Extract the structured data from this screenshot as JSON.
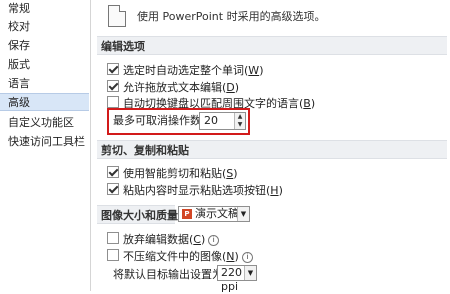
{
  "sidebar": {
    "items": [
      {
        "label": "常规"
      },
      {
        "label": "校对"
      },
      {
        "label": "保存"
      },
      {
        "label": "版式"
      },
      {
        "label": "语言"
      },
      {
        "label": "高级"
      },
      {
        "label": "自定义功能区"
      },
      {
        "label": "快速访问工具栏"
      }
    ],
    "selected": "高级"
  },
  "header": {
    "text": "使用 PowerPoint 时采用的高级选项。"
  },
  "sections": {
    "editing": {
      "title": "编辑选项",
      "options": [
        {
          "label": "选定时自动选定整个单词(",
          "key": "W",
          "suffix": ")",
          "checked": true
        },
        {
          "label": "允许拖放式文本编辑(",
          "key": "D",
          "suffix": ")",
          "checked": true
        },
        {
          "label": "自动切换键盘以匹配周围文字的语言(",
          "key": "B",
          "suffix": ")",
          "checked": false
        }
      ],
      "undo_label": "最多可取消操作数(X):",
      "undo_value": "20"
    },
    "clipboard": {
      "title": "剪切、复制和粘贴",
      "options": [
        {
          "label": "使用智能剪切和粘贴(",
          "key": "S",
          "suffix": ")",
          "checked": true
        },
        {
          "label": "粘贴内容时显示粘贴选项按钮(",
          "key": "H",
          "suffix": ")",
          "checked": true
        }
      ]
    },
    "image": {
      "title": "图像大小和质量",
      "document": "演示文稿1",
      "options": [
        {
          "label": "放弃编辑数据(",
          "key": "C",
          "suffix": ")",
          "checked": false
        },
        {
          "label": "不压缩文件中的图像(",
          "key": "N",
          "suffix": ")",
          "checked": false
        }
      ],
      "resolution_label": "将默认目标输出设置为(P):",
      "resolution_value": "220 ppi"
    }
  },
  "icons": {
    "info": "ⓘ"
  }
}
